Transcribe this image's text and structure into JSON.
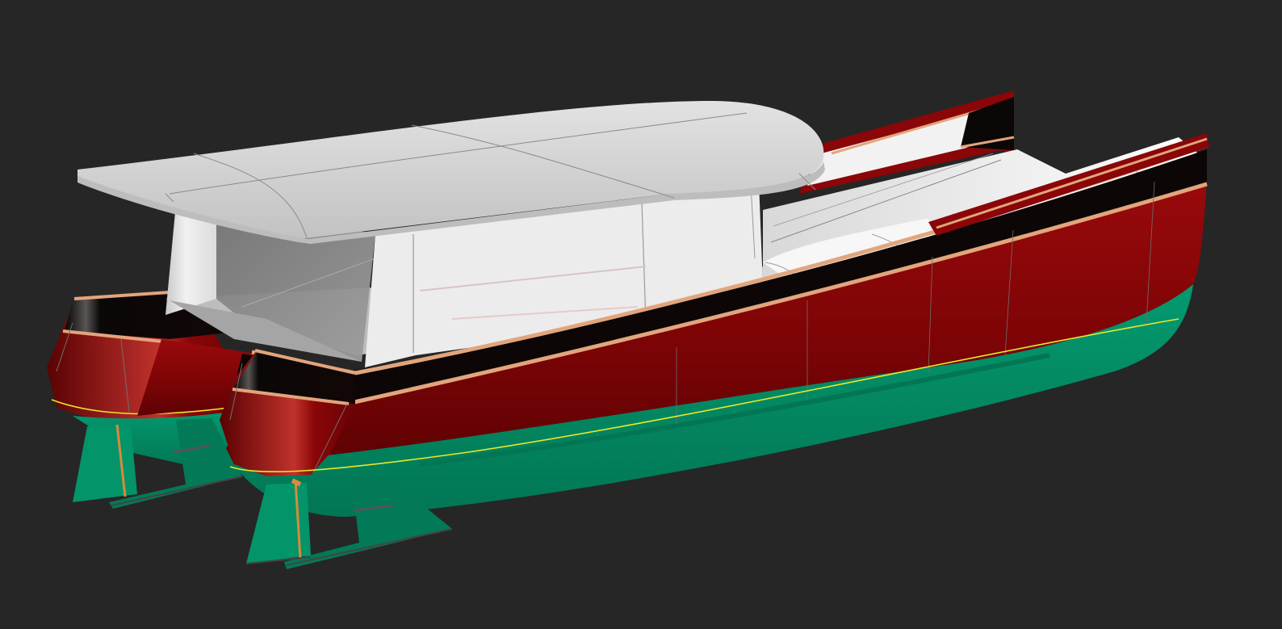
{
  "scene": {
    "subject": "catamaran-render",
    "colors": {
      "background": "#262626",
      "hull_red": "#8a0608",
      "hull_red_dark": "#5c0204",
      "hull_red_light": "#b21d1d",
      "sheer_black": "#0b0707",
      "rub_rail": "#e2a57c",
      "antifouling": "#03946a",
      "antifouling_dark": "#027a57",
      "waterline": "#e8e82a",
      "cabin_white": "#eeeeee",
      "cabin_shadow": "#b9b9b9",
      "glass": "#8a8a8a",
      "roof": "#d6d6d6",
      "roof_edge": "#c3c3c3",
      "deck": "#f4f4f4",
      "linework": "#6f6f6f",
      "rudder_pin": "#d98a3c"
    }
  }
}
